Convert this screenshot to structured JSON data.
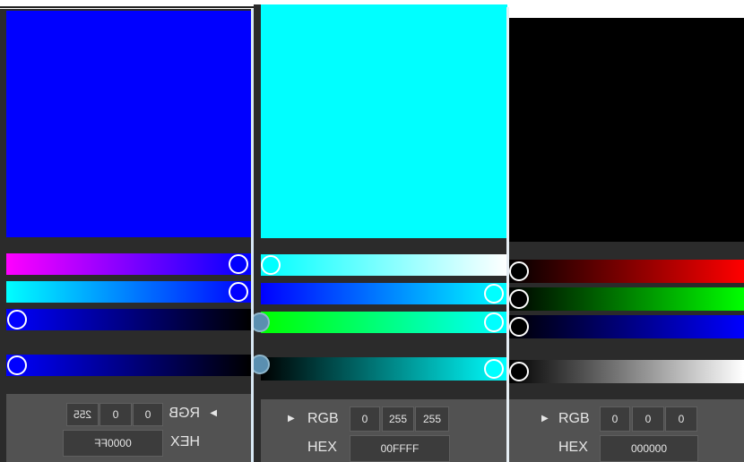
{
  "panels": [
    {
      "color_hex": "#0000ff",
      "mode_label": "RGB",
      "hex_label": "HEX",
      "rgb": [
        "0",
        "0",
        "255"
      ],
      "hex": "0000FF",
      "mirrored": true
    },
    {
      "color_hex": "#00ffff",
      "mode_label": "RGB",
      "hex_label": "HEX",
      "rgb": [
        "0",
        "255",
        "255"
      ],
      "hex": "00FFFF",
      "mirrored": false
    },
    {
      "color_hex": "#000000",
      "mode_label": "RGB",
      "hex_label": "HEX",
      "rgb": [
        "0",
        "0",
        "0"
      ],
      "hex": "000000",
      "mirrored": false
    }
  ]
}
